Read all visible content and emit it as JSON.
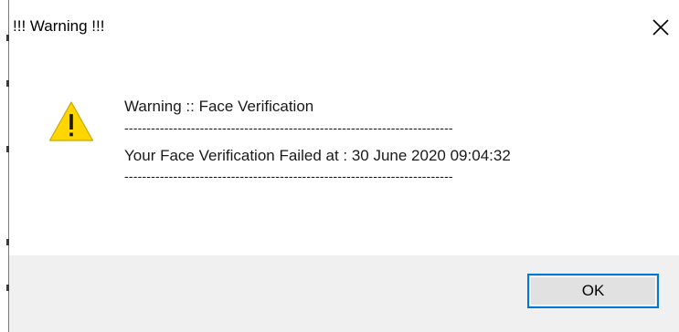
{
  "dialog": {
    "title": "!!! Warning !!!",
    "close_icon": "close-icon",
    "icon": "warning-triangle-icon",
    "colors": {
      "warning_yellow": "#ffd600",
      "footer_bg": "#f0f0f0",
      "button_bg": "#e1e1e1",
      "button_border": "#0078d7"
    },
    "message": {
      "heading": "Warning  :: Face Verification",
      "separator_top": "--------------------------------------------------------------------------",
      "body": "Your Face Verification Failed at  : 30 June 2020 09:04:32",
      "separator_bottom": "--------------------------------------------------------------------------"
    },
    "buttons": {
      "ok_label": "OK"
    }
  }
}
